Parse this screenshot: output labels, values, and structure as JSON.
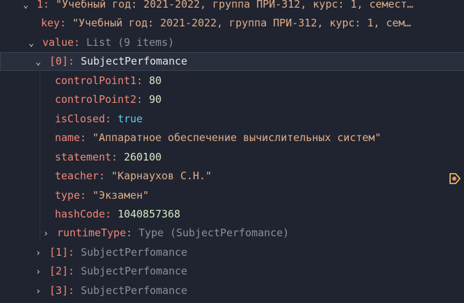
{
  "tree": {
    "row1": {
      "index": "1:",
      "value": "\"Учебный год: 2021-2022, группа ПРИ-312, курс: 1, семест…"
    },
    "key_row": {
      "key": "key:",
      "value": "\"Учебный год: 2021-2022, группа ПРИ-312, курс: 1, сем…"
    },
    "value_row": {
      "key": "value:",
      "value": "List (9 items)"
    },
    "item0": {
      "index": "[0]:",
      "type": "SubjectPerfomance"
    },
    "fields": [
      {
        "key": "controlPoint1:",
        "value": "80",
        "kind": "num"
      },
      {
        "key": "controlPoint2:",
        "value": "90",
        "kind": "num"
      },
      {
        "key": "isClosed:",
        "value": "true",
        "kind": "bool"
      },
      {
        "key": "name:",
        "value": "\"Аппаратное обеспечение вычислительных систем\"",
        "kind": "str"
      },
      {
        "key": "statement:",
        "value": "260100",
        "kind": "num"
      },
      {
        "key": "teacher:",
        "value": "\"Карнаухов С.Н.\"",
        "kind": "str"
      },
      {
        "key": "type:",
        "value": "\"Экзамен\"",
        "kind": "str"
      },
      {
        "key": "hashCode:",
        "value": "1040857368",
        "kind": "num"
      }
    ],
    "runtime": {
      "key": "runtimeType:",
      "value": "Type (SubjectPerfomance)"
    },
    "items": [
      {
        "index": "[1]:",
        "type": "SubjectPerfomance"
      },
      {
        "index": "[2]:",
        "type": "SubjectPerfomance"
      },
      {
        "index": "[3]:",
        "type": "SubjectPerfomance"
      }
    ]
  },
  "icons": {
    "expanded": "chevron-down-icon",
    "collapsed": "chevron-right-icon",
    "side": "breakpoint-icon"
  },
  "colors": {
    "background": "#1f2430",
    "key": "#f28779",
    "string": "#e1ad88",
    "number": "#d9e8c4",
    "boolean": "#5ccfe6",
    "dim": "#8a909c",
    "breakpoint": "#ffcc66"
  }
}
